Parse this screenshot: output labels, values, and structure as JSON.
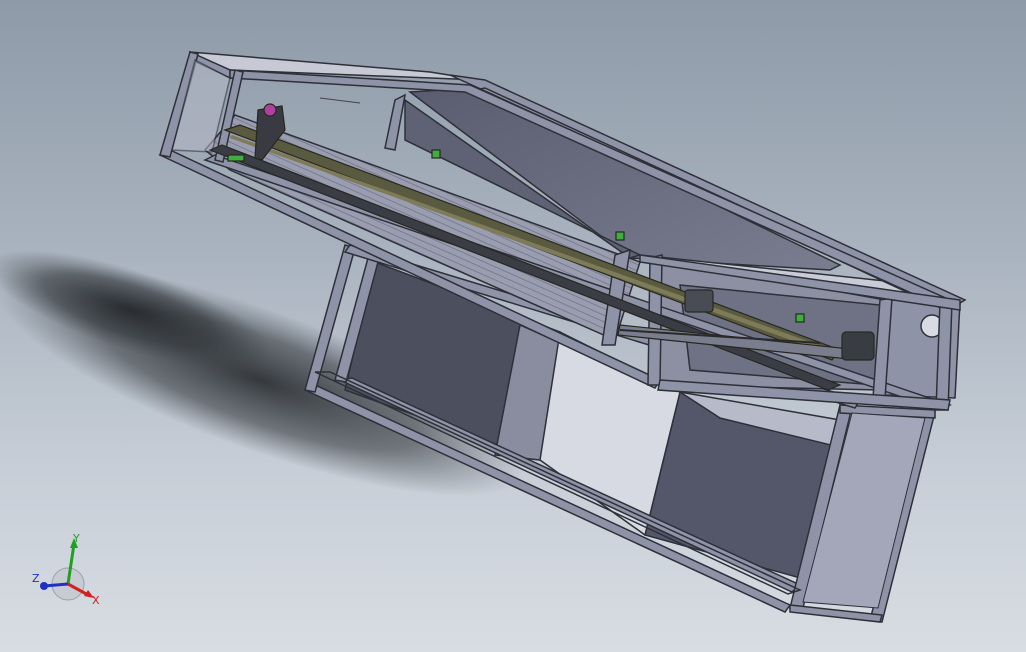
{
  "viewport": {
    "background_top": "#8e9aa8",
    "background_bottom": "#d8dde3"
  },
  "model": {
    "frame_color": "#8f93a8",
    "frame_edge": "#2e3038",
    "panel_color": "#6b6e80",
    "panel_dark": "#4c4f5e",
    "panel_light": "#c9cbd6",
    "rail_color": "#5a5a40",
    "accent_green": "#3fae3f",
    "accent_magenta": "#b040a0"
  },
  "triad": {
    "x_label": "X",
    "y_label": "Y",
    "z_label": "Z",
    "x_color": "#d42020",
    "y_color": "#20a020",
    "z_color": "#2030c0"
  }
}
